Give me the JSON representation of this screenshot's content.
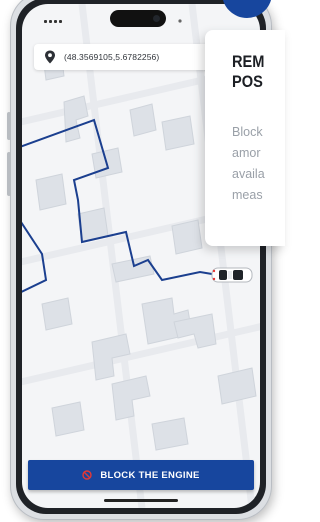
{
  "location": {
    "coordinates": "(48.3569105,5.6782256)"
  },
  "action_button": {
    "label": "BLOCK THE ENGINE"
  },
  "info_card": {
    "title": "REM\nPOS",
    "body": "Block\namor\navaila\nmeas"
  },
  "icons": {
    "location": "map-pin-icon",
    "action": "ban-icon",
    "vehicle": "car-icon"
  },
  "colors": {
    "brand_blue": "#17469e",
    "route": "#1b3f8f",
    "ban_red": "#e53935",
    "map_bg": "#f4f5f7",
    "map_blocks": "#dde1e7"
  }
}
